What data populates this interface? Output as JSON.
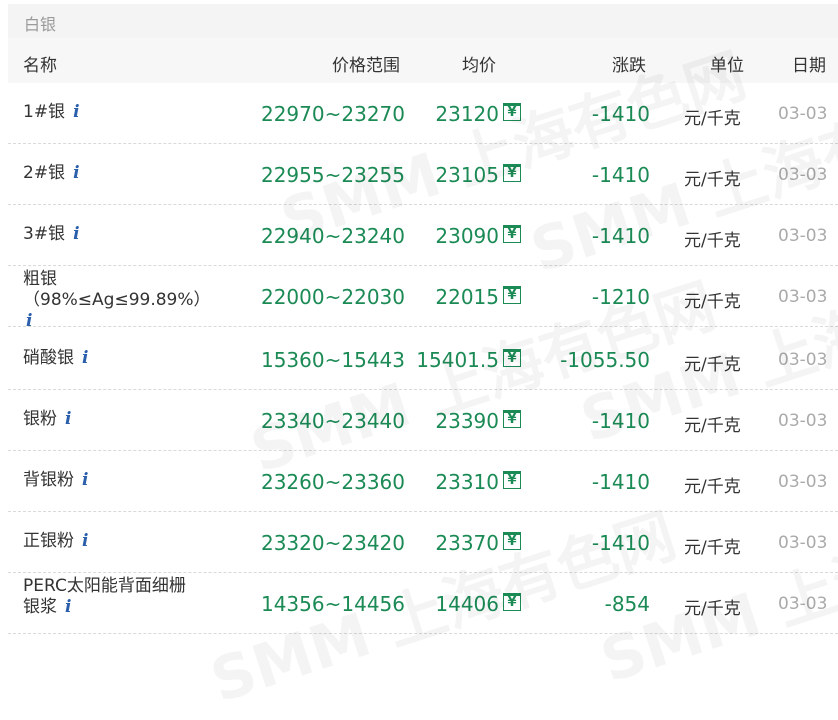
{
  "section": {
    "title": "白银"
  },
  "columns": {
    "name": "名称",
    "range": "价格范围",
    "avg": "均价",
    "change": "涨跌",
    "unit": "单位",
    "date": "日期"
  },
  "info_icon": "i",
  "yen_icon": "¥",
  "watermark": "SMM 上海有色网",
  "rows": [
    {
      "name": "1#银",
      "range": "22970~23270",
      "avg": "23120",
      "change": "-1410",
      "unit": "元/千克",
      "date": "03-03"
    },
    {
      "name": "2#银",
      "range": "22955~23255",
      "avg": "23105",
      "change": "-1410",
      "unit": "元/千克",
      "date": "03-03"
    },
    {
      "name": "3#银",
      "range": "22940~23240",
      "avg": "23090",
      "change": "-1410",
      "unit": "元/千克",
      "date": "03-03"
    },
    {
      "name": "粗银",
      "name_sub": "（98%≤Ag≤99.89%）",
      "range": "22000~22030",
      "avg": "22015",
      "change": "-1210",
      "unit": "元/千克",
      "date": "03-03"
    },
    {
      "name": "硝酸银",
      "range": "15360~15443",
      "avg": "15401.5",
      "change": "-1055.50",
      "unit": "元/千克",
      "date": "03-03"
    },
    {
      "name": "银粉",
      "range": "23340~23440",
      "avg": "23390",
      "change": "-1410",
      "unit": "元/千克",
      "date": "03-03"
    },
    {
      "name": "背银粉",
      "range": "23260~23360",
      "avg": "23310",
      "change": "-1410",
      "unit": "元/千克",
      "date": "03-03"
    },
    {
      "name": "正银粉",
      "range": "23320~23420",
      "avg": "23370",
      "change": "-1410",
      "unit": "元/千克",
      "date": "03-03"
    },
    {
      "name": "PERC太阳能背面细栅",
      "name_sub": "银浆",
      "range": "14356~14456",
      "avg": "14406",
      "change": "-854",
      "unit": "元/千克",
      "date": "03-03"
    }
  ]
}
